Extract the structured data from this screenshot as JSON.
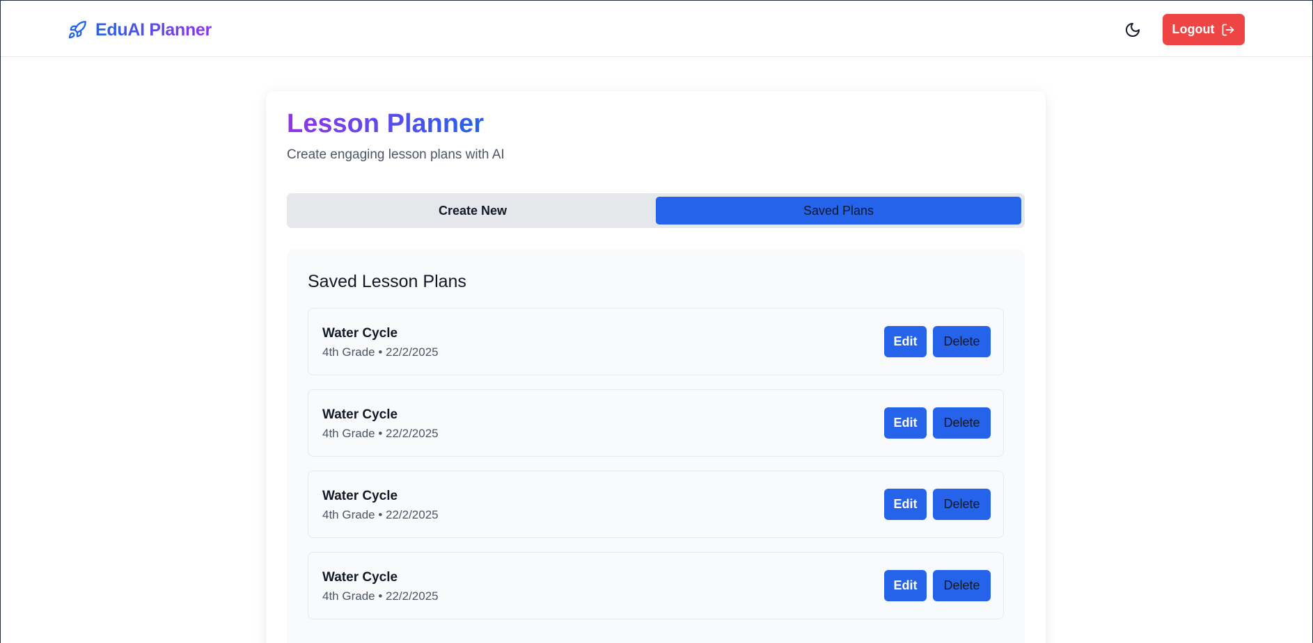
{
  "header": {
    "brand": "EduAI Planner",
    "logout_label": "Logout"
  },
  "page": {
    "title": "Lesson Planner",
    "subtitle": "Create engaging lesson plans with AI"
  },
  "tabs": [
    {
      "label": "Create New",
      "active": false
    },
    {
      "label": "Saved Plans",
      "active": true
    }
  ],
  "saved": {
    "heading": "Saved Lesson Plans",
    "plans": [
      {
        "title": "Water Cycle",
        "meta": "4th Grade • 22/2/2025",
        "edit_label": "Edit",
        "delete_label": "Delete"
      },
      {
        "title": "Water Cycle",
        "meta": "4th Grade • 22/2/2025",
        "edit_label": "Edit",
        "delete_label": "Delete"
      },
      {
        "title": "Water Cycle",
        "meta": "4th Grade • 22/2/2025",
        "edit_label": "Edit",
        "delete_label": "Delete"
      },
      {
        "title": "Water Cycle",
        "meta": "4th Grade • 22/2/2025",
        "edit_label": "Edit",
        "delete_label": "Delete"
      }
    ]
  },
  "icons": {
    "brand": "rocket-icon",
    "theme": "moon-icon",
    "logout": "log-out-icon"
  },
  "colors": {
    "accent_blue": "#2563eb",
    "accent_purple": "#9333ea",
    "danger": "#ef4444"
  }
}
